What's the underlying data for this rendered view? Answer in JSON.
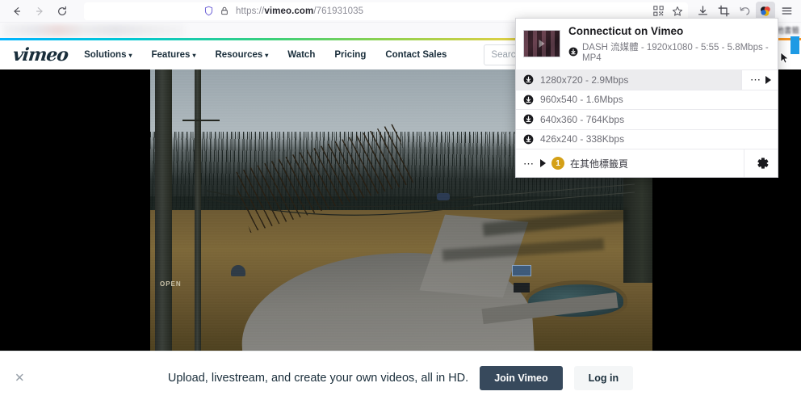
{
  "browser": {
    "nav": {
      "back_icon": "arrow-left-icon",
      "forward_icon": "arrow-right-icon",
      "reload_icon": "reload-icon"
    },
    "address_bar": {
      "shield_icon": "shield-icon",
      "lock_icon": "lock-icon",
      "url_prefix": "https://",
      "url_domain": "vimeo.com",
      "url_path": "/761931035",
      "qr_icon": "qr-code-icon",
      "bookmark_icon": "star-icon"
    },
    "toolbar_right": [
      {
        "name": "downloads-icon",
        "label": "download-arrow-icon"
      },
      {
        "name": "screenshot-icon",
        "label": "crop-icon"
      },
      {
        "name": "undo-icon",
        "label": "undo-arrow-icon"
      },
      {
        "name": "extension-icon",
        "label": "video-downloadhelper-icon"
      },
      {
        "name": "menu-icon",
        "label": "hamburger-menu-icon"
      }
    ],
    "bookmarks_bar": {
      "other_bookmarks_label": "他書籤"
    }
  },
  "popup": {
    "title": "Connecticut on Vimeo",
    "download_icon": "download-circle-icon",
    "subtitle": "DASH 流媒體 - 1920x1080 - 5:55 - 5.8Mbps - MP4",
    "thumbnail_name": "video-thumbnail",
    "qualities": [
      {
        "label": "1280x720 - 2.9Mbps",
        "selected": true
      },
      {
        "label": "960x540 - 1.6Mbps",
        "selected": false
      },
      {
        "label": "640x360 - 764Kbps",
        "selected": false
      },
      {
        "label": "426x240 - 338Kbps",
        "selected": false
      }
    ],
    "row_more_icon": "ellipsis-icon",
    "row_arrow_icon": "play-triangle-icon",
    "footer": {
      "more_icon": "ellipsis-icon",
      "arrow_icon": "play-triangle-icon",
      "badge_count": "1",
      "label": "在其他標籤頁",
      "settings_icon": "gear-icon"
    }
  },
  "site": {
    "logo": "vimeo",
    "nav_items": [
      {
        "label": "Solutions",
        "has_caret": true
      },
      {
        "label": "Features",
        "has_caret": true
      },
      {
        "label": "Resources",
        "has_caret": true
      },
      {
        "label": "Watch",
        "has_caret": false
      },
      {
        "label": "Pricing",
        "has_caret": false
      },
      {
        "label": "Contact Sales",
        "has_caret": false
      }
    ],
    "search": {
      "placeholder": "Search videos",
      "value": ""
    },
    "video": {
      "name": "video-player",
      "scene": "rural road with utility poles, bare trees, dry field and pond"
    },
    "banner": {
      "close_icon": "close-x-icon",
      "text": "Upload, livestream, and create your own videos, all in HD.",
      "primary_button": "Join Vimeo",
      "secondary_button": "Log in"
    }
  },
  "colors": {
    "vimeo_dark": "#37495c",
    "badge_yellow": "#d4a017",
    "accent_blue": "#1e9ae4",
    "stripe_start": "#00b3ff",
    "stripe_end": "#f7931e"
  }
}
